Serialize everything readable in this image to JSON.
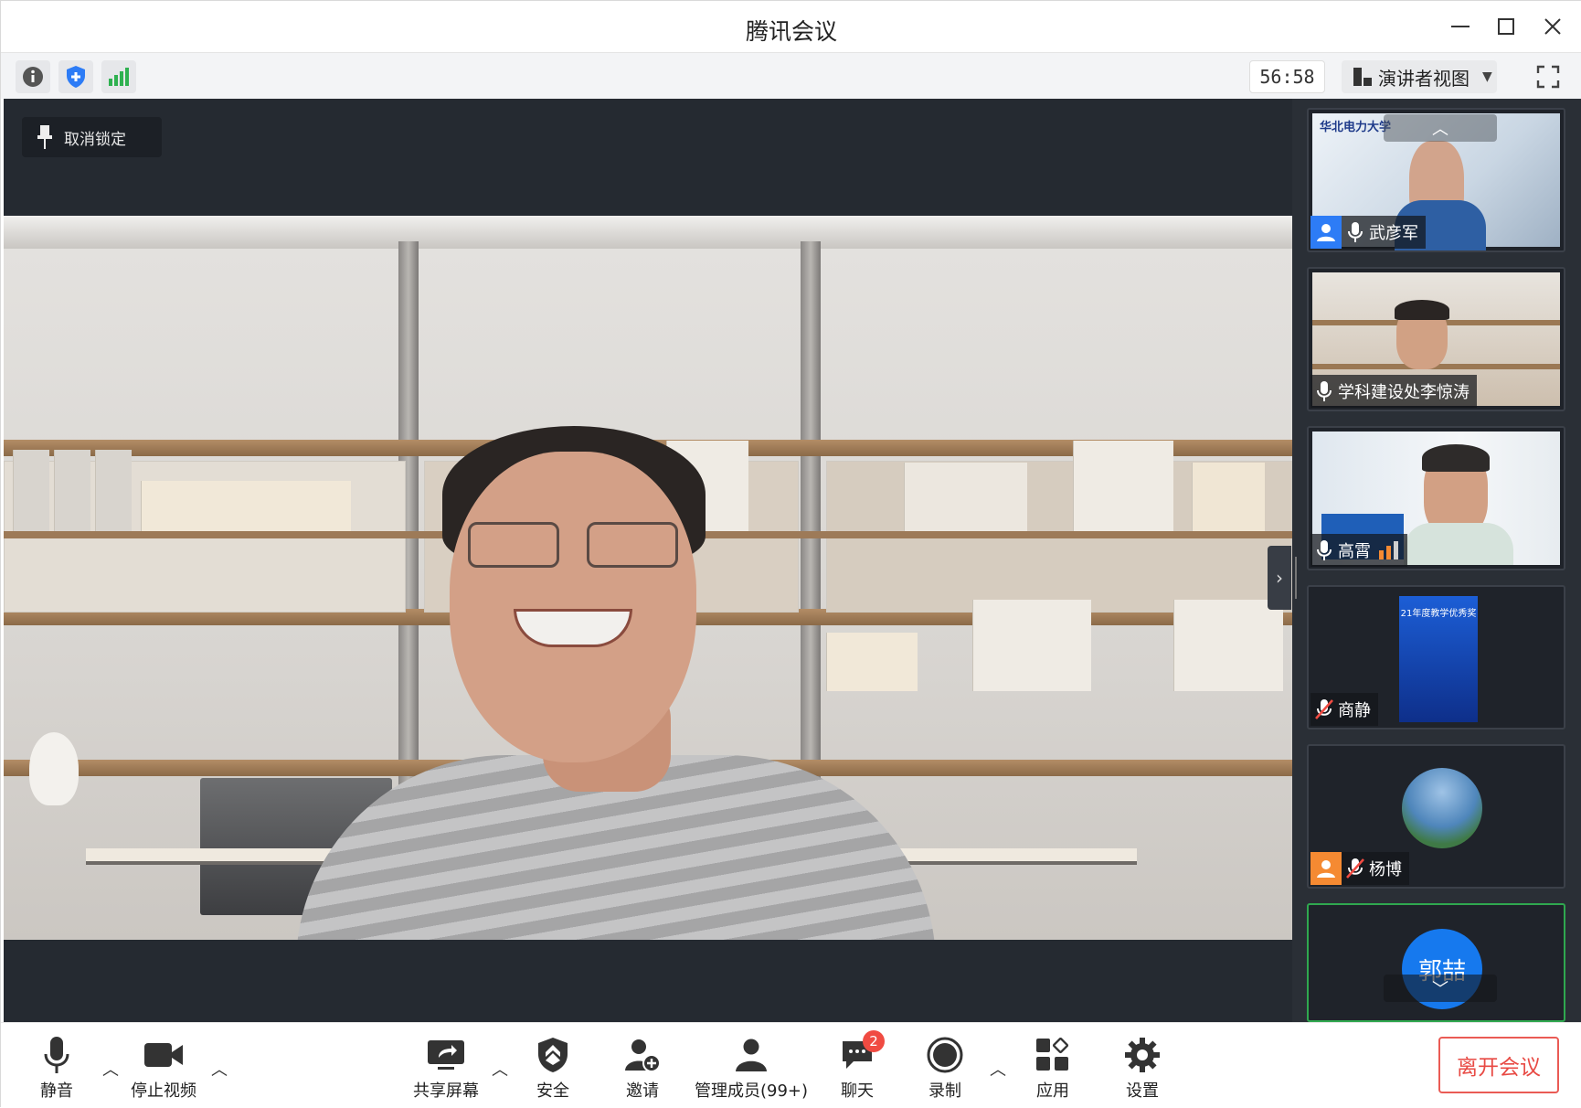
{
  "window": {
    "title": "腾讯会议"
  },
  "infobar": {
    "timer": "56:58",
    "view_label": "演讲者视图",
    "icons": [
      "info-icon",
      "shield-icon",
      "signal-icon",
      "view-layout-icon",
      "fullscreen-icon"
    ]
  },
  "main": {
    "unpin_label": "取消锁定"
  },
  "participants": [
    {
      "name": "武彦军",
      "mic": "on",
      "avatar_badge": "blue",
      "slide_header": "华北电力大学"
    },
    {
      "name": "学科建设处李惊涛",
      "mic": "on"
    },
    {
      "name": "高霄",
      "mic": "on",
      "signal": "speaking"
    },
    {
      "name": "商静",
      "mic": "muted",
      "slide_title": "21年度教学优秀奖"
    },
    {
      "name": "杨博",
      "mic": "muted",
      "avatar_badge": "orange"
    },
    {
      "name": "郭喆",
      "avatar_text": "郭喆",
      "active": true
    }
  ],
  "toolbar": {
    "mute": "静音",
    "stop_video": "停止视频",
    "share_screen": "共享屏幕",
    "security": "安全",
    "invite": "邀请",
    "manage_members": "管理成员(99+)",
    "chat": "聊天",
    "chat_badge": "2",
    "record": "录制",
    "apps": "应用",
    "settings": "设置",
    "leave": "离开会议"
  },
  "colors": {
    "accent_blue": "#2d7cf6",
    "leave_red": "#e84a44",
    "active_green": "#2fa84f",
    "stage_bg": "#252a31"
  }
}
